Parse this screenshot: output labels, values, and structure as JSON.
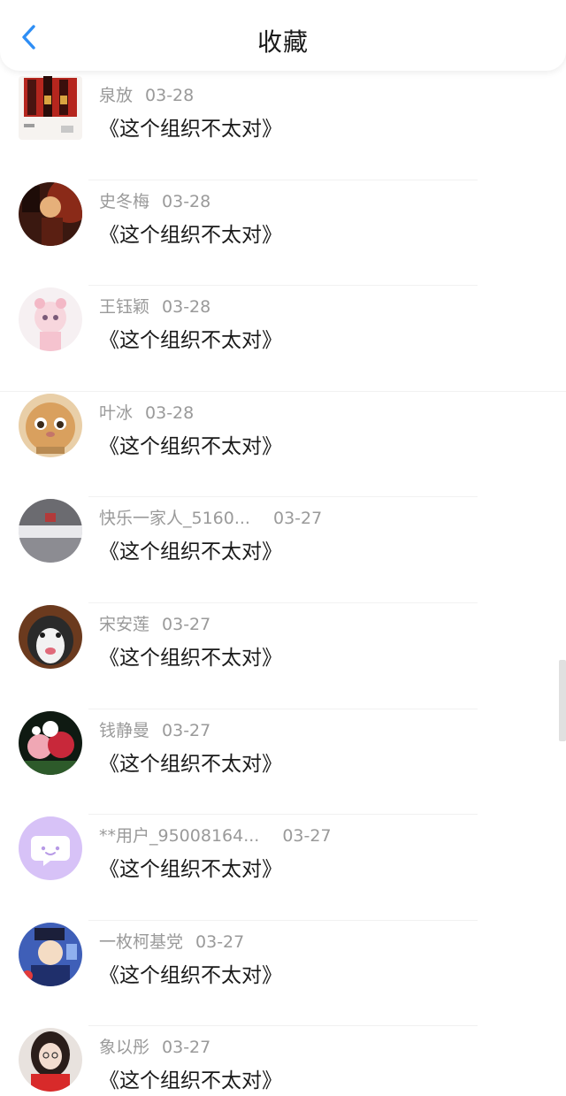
{
  "header": {
    "title": "收藏"
  },
  "items": [
    {
      "name": "泉放",
      "date": "03-28",
      "content": "《这个组织不太对》"
    },
    {
      "name": "史冬梅",
      "date": "03-28",
      "content": "《这个组织不太对》"
    },
    {
      "name": "王钰颖",
      "date": "03-28",
      "content": "《这个组织不太对》"
    },
    {
      "name": "叶冰",
      "date": "03-28",
      "content": "《这个组织不太对》"
    },
    {
      "name": "快乐一家人_5160...",
      "date": "03-27",
      "content": "《这个组织不太对》"
    },
    {
      "name": "宋安莲",
      "date": "03-27",
      "content": "《这个组织不太对》"
    },
    {
      "name": "钱静曼",
      "date": "03-27",
      "content": "《这个组织不太对》"
    },
    {
      "name": "**用户_95008164...",
      "date": "03-27",
      "content": "《这个组织不太对》"
    },
    {
      "name": "一枚柯基党",
      "date": "03-27",
      "content": "《这个组织不太对》"
    },
    {
      "name": "象以彤",
      "date": "03-27",
      "content": "《这个组织不太对》"
    }
  ],
  "colors": {
    "accent": "#2e8ef5",
    "meta_text": "#9a9a9a",
    "title_text": "#1a1a1a",
    "default_avatar_bg": "#d7c2f7"
  }
}
